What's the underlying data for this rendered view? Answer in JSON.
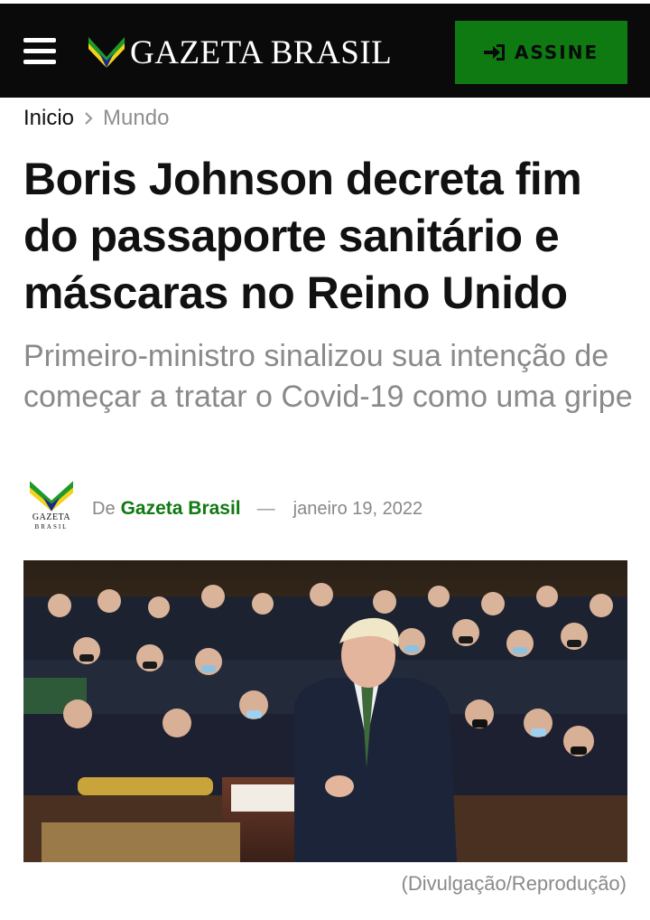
{
  "header": {
    "logo_text": "GAZETA BRASIL",
    "logo_icon": "gazeta-brasil-chevron-logo",
    "menu_icon": "hamburger-menu-icon",
    "subscribe_label": "ASSINE",
    "subscribe_icon": "sign-in-icon",
    "colors": {
      "bar": "#0a0a0a",
      "subscribe_bg": "#0f7a12",
      "logo_green": "#1f9a2a",
      "logo_yellow": "#f3d21a",
      "logo_blue": "#1a2a8a"
    }
  },
  "breadcrumb": {
    "home": "Inicio",
    "separator_icon": "chevron-right-icon",
    "current": "Mundo"
  },
  "article": {
    "title": "Boris Johnson decreta fim do passaporte sanitário e máscaras no Reino Unido",
    "subtitle": "Primeiro-ministro sinalizou sua intenção de começar a tratar o Covid-19 como uma gripe",
    "byline": {
      "prefix": "De",
      "author": "Gazeta Brasil",
      "separator": "—",
      "date": "janeiro 19, 2022",
      "avatar_text": "GAZETA",
      "avatar_text_2": "BRASIL"
    },
    "image": {
      "subject": "Boris Johnson speaking in the House of Commons",
      "caption": "(Divulgação/Reprodução)"
    }
  }
}
